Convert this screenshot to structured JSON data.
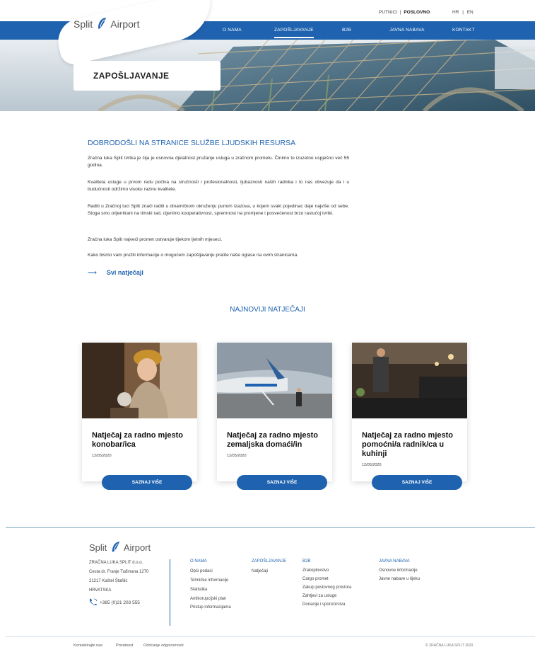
{
  "header": {
    "top_links": {
      "passengers": "PUTNICI",
      "separator": "|",
      "business": "POSLOVNO"
    },
    "langs": {
      "hr": "HR",
      "sep": "|",
      "en": "EN"
    },
    "logo": {
      "left": "Split",
      "right": "Airport"
    },
    "nav": [
      "O NAMA",
      "ZAPOŠLJAVANJE",
      "B2B",
      "JAVNA NABAVA",
      "KONTAKT"
    ],
    "active_nav": "ZAPOŠLJAVANJE"
  },
  "hero": {
    "title": "ZAPOŠLJAVANJE"
  },
  "intro": {
    "heading": "DOBRODOŠLI NA STRANICE SLUŽBE LJUDSKIH RESURSA",
    "paragraphs": [
      "Zračna luka Split tvrtka je čija je osnovna djelatnost pružanje usluga u zračnom prometu. Činimo to izuzetno uspješno već 55 godina.",
      "Kvaliteta usluge u prvom redu počiva na stručnosti i profesionalnosti, ljubaznosti naših radnika i to nas obvezuje da i u budućnosti održimo visoku razinu kvalitete.",
      "Raditi u Zračnoj luci Split znači raditi u dinamičkom okruženju punom izazova, u kojem svaki pojedinac daje najviše od sebe. Stoga smo orijentirani na timski rad, cijenimo kooperativnost, spremnost na promjene i posvećenost brzo rastućoj tvrtki.",
      "Zračna luka Split najveći promet ostvaruje tijekom ljetnih mjeseci.",
      "Kako bismo vam pružili informacije o mogućem zapošljavanju pratite naše oglase na ovim stranicama."
    ],
    "all_link_arrow": "⟶",
    "all_link": "Svi natječaji"
  },
  "jobs": {
    "title": "NAJNOVIJI NATJEČAJI",
    "cards": [
      {
        "title": "Natječaj za radno mjesto konobar/ica",
        "date": "12/05/2020",
        "button": "SAZNAJ VIŠE"
      },
      {
        "title": "Natječaj za radno mjesto zemaljska domaći/in",
        "date": "12/05/2020",
        "button": "SAZNAJ VIŠE"
      },
      {
        "title": "Natječaj za radno mjesto pomoćni/a radnik/ca u kuhinji",
        "date": "12/05/2020",
        "button": "SAZNAJ VIŠE"
      }
    ]
  },
  "footer": {
    "logo": {
      "left": "Split",
      "right": "Airport"
    },
    "address": [
      "ZRAČNA LUKA SPLIT d.o.o.",
      "Cesta dr. Franje Tuđmana 1270",
      "21217 Kaštel Štafilić",
      "HRVATSKA"
    ],
    "phone": "+385 (0)21 203 555",
    "columns": [
      {
        "head": "O NAMA",
        "items": [
          "Opći podaci",
          "Tehničke informacije",
          "Statistika",
          "Antikorupcijski plan",
          "Pristup informacijama"
        ]
      },
      {
        "head": "ZAPOŠLJAVANJE",
        "items": [
          "Natječaji"
        ]
      },
      {
        "head": "B2B",
        "items": [
          "Zrakoplovstvo",
          "Cargo promet",
          "Zakup poslovnog prostora",
          "Zahtjevi za usluge",
          "Donacije i sponzorstva"
        ]
      },
      {
        "head": "JAVNA NABAVA",
        "items": [
          "Osnovne informacije",
          "Javne nabave u tijeku"
        ]
      }
    ],
    "bottom_links": [
      "Kontaktirajte nas",
      "Privatnost",
      "Odricanje odgovornosti"
    ],
    "copyright": "© ZRAČNA LUKA SPLIT 2020"
  },
  "colors": {
    "brand_blue": "#1f63b0",
    "footer_line": "#7fb3c4"
  }
}
